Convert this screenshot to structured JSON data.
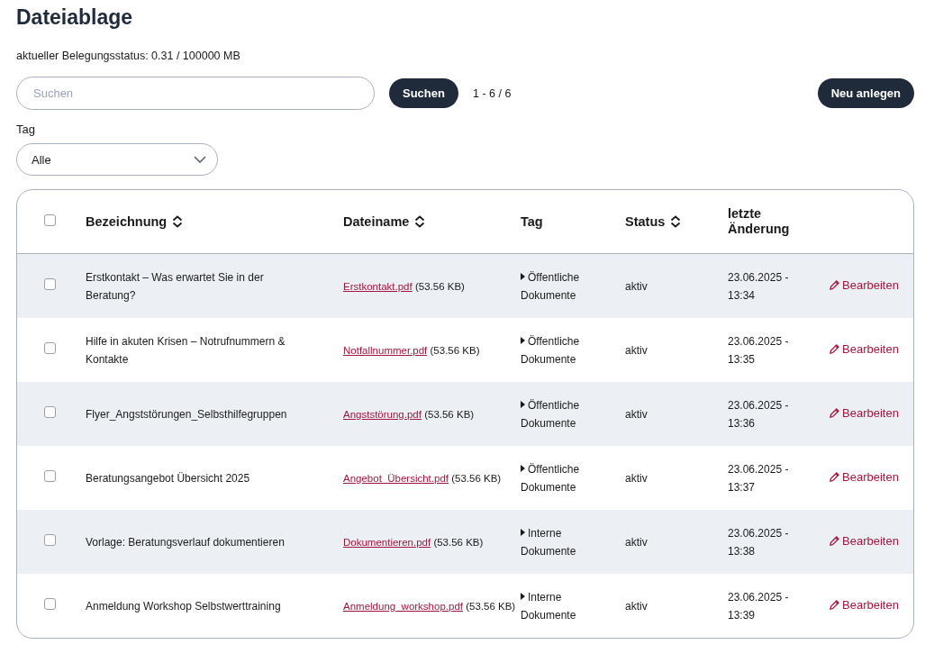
{
  "title": "Dateiablage",
  "usage": "aktueller Belegungsstatus: 0.31 / 100000 MB",
  "search": {
    "placeholder": "Suchen",
    "button": "Suchen",
    "count": "1 - 6 / 6"
  },
  "new_button": "Neu anlegen",
  "tag_filter": {
    "label": "Tag",
    "value": "Alle"
  },
  "table": {
    "select_all_checked": false,
    "columns": [
      {
        "label": "Bezeichnung",
        "sortable": true
      },
      {
        "label": "Dateiname",
        "sortable": true
      },
      {
        "label": "Tag",
        "sortable": false
      },
      {
        "label": "Status",
        "sortable": true
      },
      {
        "label": "letzte Änderung",
        "sortable": false
      }
    ],
    "rows": [
      {
        "checked": false,
        "name": "Erstkontakt – Was erwartet Sie in der Beratung?",
        "file": "Erstkontakt.pdf",
        "size": "(53.56 KB)",
        "tag": "Öffentliche Dokumente",
        "status": "aktiv",
        "date": "23.06.2025 - 13:34",
        "action": "Bearbeiten"
      },
      {
        "checked": false,
        "name": "Hilfe in akuten Krisen – Notrufnummern & Kontakte",
        "file": "Notfallnummer.pdf",
        "size": "(53.56 KB)",
        "tag": "Öffentliche Dokumente",
        "status": "aktiv",
        "date": "23.06.2025 - 13:35",
        "action": "Bearbeiten"
      },
      {
        "checked": false,
        "name": "Flyer_Angststörungen_Selbsthilfegruppen",
        "file": "Angststörung.pdf",
        "size": "(53.56 KB)",
        "tag": "Öffentliche Dokumente",
        "status": "aktiv",
        "date": "23.06.2025 - 13:36",
        "action": "Bearbeiten"
      },
      {
        "checked": false,
        "name": "Beratungsangebot Übersicht 2025",
        "file": "Angebot_Übersicht.pdf",
        "size": "(53.56 KB)",
        "tag": "Öffentliche Dokumente",
        "status": "aktiv",
        "date": "23.06.2025 - 13:37",
        "action": "Bearbeiten"
      },
      {
        "checked": false,
        "name": "Vorlage: Beratungsverlauf dokumentieren",
        "file": "Dokumentieren.pdf",
        "size": "(53.56 KB)",
        "tag": "Interne Dokumente",
        "status": "aktiv",
        "date": "23.06.2025 - 13:38",
        "action": "Bearbeiten"
      },
      {
        "checked": false,
        "name": "Anmeldung Workshop Selbstwerttraining",
        "file": "Anmeldung_workshop.pdf",
        "size": "(53.56 KB)",
        "tag": "Interne Dokumente",
        "status": "aktiv",
        "date": "23.06.2025 - 13:39",
        "action": "Bearbeiten"
      }
    ]
  }
}
